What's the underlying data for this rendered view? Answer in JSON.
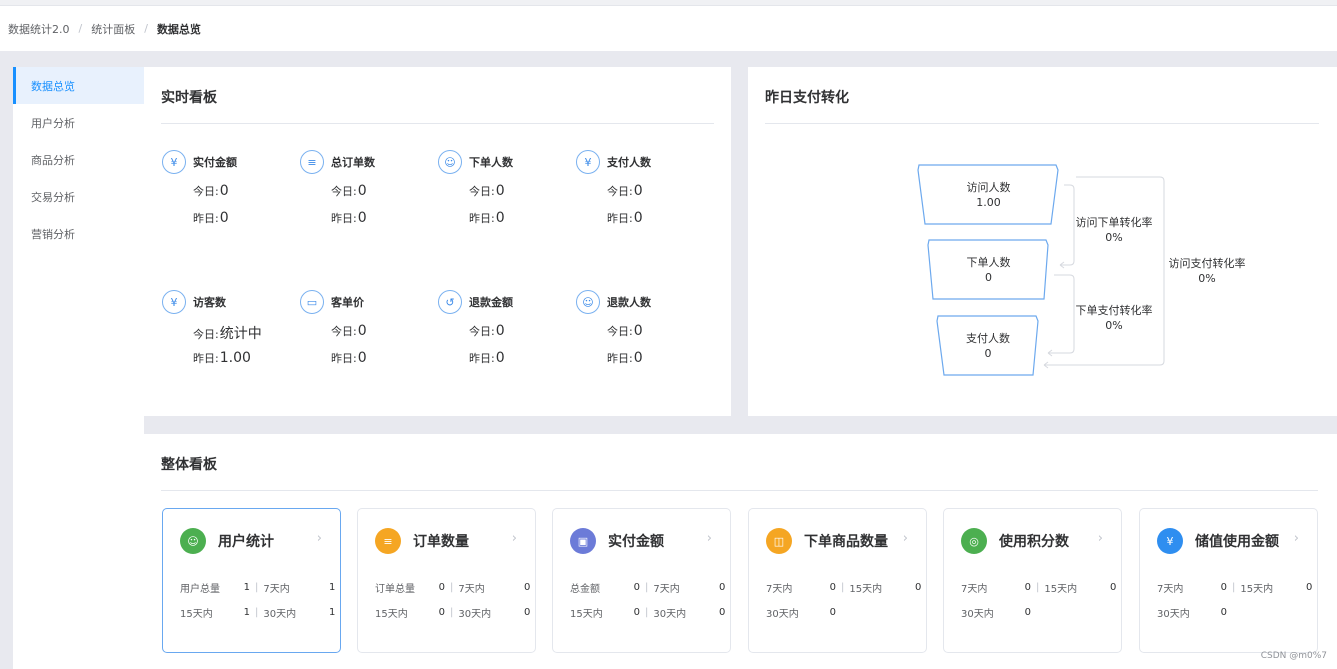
{
  "breadcrumb": [
    "数据统计2.0",
    "统计面板",
    "数据总览"
  ],
  "sidebar": [
    {
      "label": "数据总览",
      "active": true
    },
    {
      "label": "用户分析",
      "active": false
    },
    {
      "label": "商品分析",
      "active": false
    },
    {
      "label": "交易分析",
      "active": false
    },
    {
      "label": "营销分析",
      "active": false
    }
  ],
  "realtime": {
    "title": "实时看板",
    "stats": [
      {
        "label": "实付金额",
        "icon": "money-bag-icon",
        "today_key": "今日:",
        "today": "0",
        "yesterday_key": "昨日:",
        "yesterday": "0"
      },
      {
        "label": "总订单数",
        "icon": "order-list-icon",
        "today_key": "今日:",
        "today": "0",
        "yesterday_key": "昨日:",
        "yesterday": "0"
      },
      {
        "label": "下单人数",
        "icon": "user-icon",
        "today_key": "今日:",
        "today": "0",
        "yesterday_key": "昨日:",
        "yesterday": "0"
      },
      {
        "label": "支付人数",
        "icon": "money-bag-icon",
        "today_key": "今日:",
        "today": "0",
        "yesterday_key": "昨日:",
        "yesterday": "0"
      },
      {
        "label": "访客数",
        "icon": "money-bag-icon",
        "today_key": "今日:",
        "today": "统计中",
        "yesterday_key": "昨日:",
        "yesterday": "1.00"
      },
      {
        "label": "客单价",
        "icon": "ticket-icon",
        "today_key": "今日:",
        "today": "0",
        "yesterday_key": "昨日:",
        "yesterday": "0"
      },
      {
        "label": "退款金额",
        "icon": "refund-icon",
        "today_key": "今日:",
        "today": "0",
        "yesterday_key": "昨日:",
        "yesterday": "0"
      },
      {
        "label": "退款人数",
        "icon": "user-refund-icon",
        "today_key": "今日:",
        "today": "0",
        "yesterday_key": "昨日:",
        "yesterday": "0"
      }
    ]
  },
  "funnel": {
    "title": "昨日支付转化",
    "stages": [
      {
        "label": "访问人数",
        "value": "1.00"
      },
      {
        "label": "下单人数",
        "value": "0"
      },
      {
        "label": "支付人数",
        "value": "0"
      }
    ],
    "conversions": [
      {
        "label": "访问下单转化率",
        "value": "0%"
      },
      {
        "label": "下单支付转化率",
        "value": "0%"
      },
      {
        "label": "访问支付转化率",
        "value": "0%"
      }
    ]
  },
  "overall": {
    "title": "整体看板",
    "cards": [
      {
        "title": "用户统计",
        "icon": "user-icon",
        "color": "#4caf50",
        "active": true,
        "rows": [
          [
            [
              "用户总量",
              "1"
            ],
            [
              "7天内",
              "1"
            ]
          ],
          [
            [
              "15天内",
              "1"
            ],
            [
              "30天内",
              "1"
            ]
          ]
        ]
      },
      {
        "title": "订单数量",
        "icon": "order-icon",
        "color": "#f5a623",
        "active": false,
        "rows": [
          [
            [
              "订单总量",
              "0"
            ],
            [
              "7天内",
              "0"
            ]
          ],
          [
            [
              "15天内",
              "0"
            ],
            [
              "30天内",
              "0"
            ]
          ]
        ]
      },
      {
        "title": "实付金额",
        "icon": "wallet-icon",
        "color": "#6c7bd8",
        "active": false,
        "rows": [
          [
            [
              "总金额",
              "0"
            ],
            [
              "7天内",
              "0"
            ]
          ],
          [
            [
              "15天内",
              "0"
            ],
            [
              "30天内",
              "0"
            ]
          ]
        ]
      },
      {
        "title": "下单商品数量",
        "icon": "bag-icon",
        "color": "#f5a623",
        "active": false,
        "rows": [
          [
            [
              "7天内",
              "0"
            ],
            [
              "15天内",
              "0"
            ]
          ],
          [
            [
              "30天内",
              "0"
            ]
          ]
        ]
      },
      {
        "title": "使用积分数",
        "icon": "coin-stack-icon",
        "color": "#4caf50",
        "active": false,
        "rows": [
          [
            [
              "7天内",
              "0"
            ],
            [
              "15天内",
              "0"
            ]
          ],
          [
            [
              "30天内",
              "0"
            ]
          ]
        ]
      },
      {
        "title": "储值使用金额",
        "icon": "money-bag-icon",
        "color": "#2f8ef0",
        "active": false,
        "rows": [
          [
            [
              "7天内",
              "0"
            ],
            [
              "15天内",
              "0"
            ]
          ],
          [
            [
              "30天内",
              "0"
            ]
          ]
        ]
      }
    ]
  },
  "watermark": "CSDN @m0%7"
}
